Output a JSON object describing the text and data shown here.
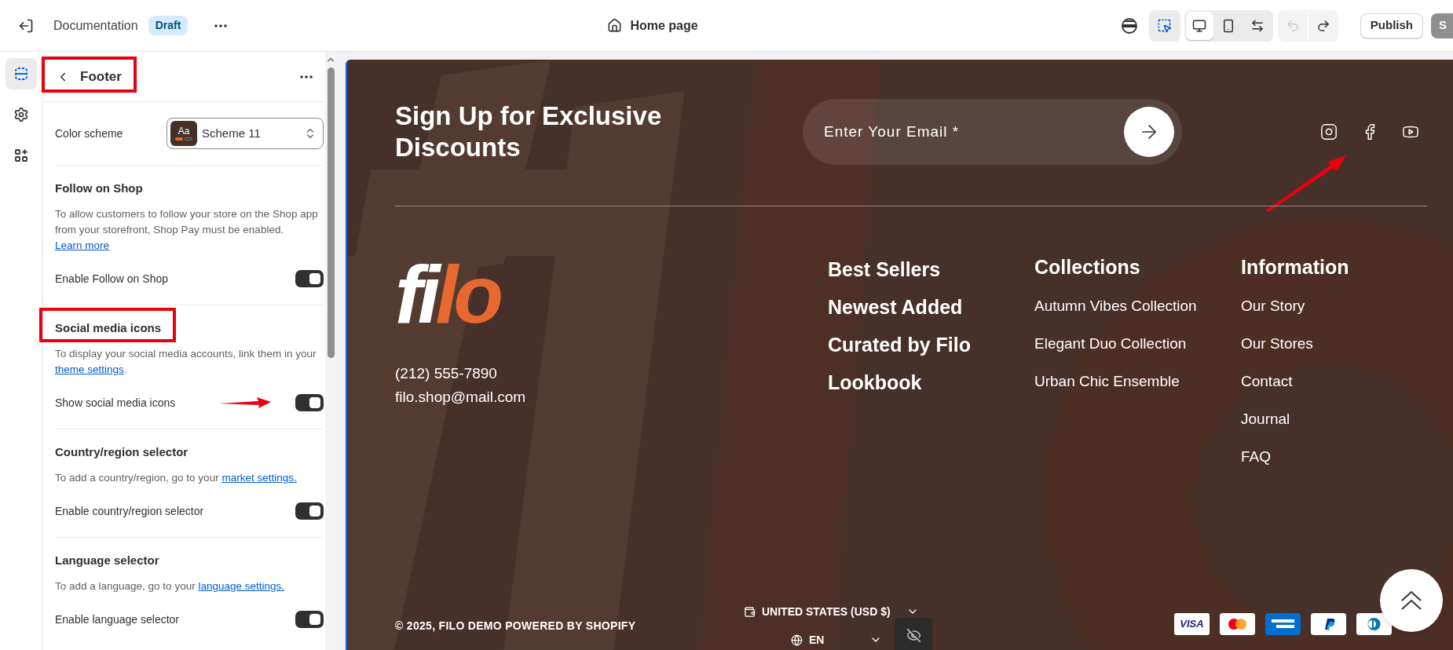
{
  "topbar": {
    "store": "Documentation",
    "status_badge": "Draft",
    "page": "Home page",
    "inspector_selected": true,
    "device_modes": [
      {
        "kind": "desktop",
        "selected": true
      },
      {
        "kind": "mobile",
        "selected": false
      },
      {
        "kind": "fullwidth",
        "selected": false
      }
    ],
    "undo_disabled": true,
    "redo_disabled": false,
    "publish": "Publish",
    "save": "S"
  },
  "rail": [
    {
      "kind": "sections",
      "selected": true
    },
    {
      "kind": "settings",
      "selected": false
    },
    {
      "kind": "apps",
      "selected": false
    }
  ],
  "panel": {
    "title": "Footer",
    "title_annotated": true,
    "color_scheme": {
      "label": "Color scheme",
      "swatch": "Aa",
      "value": "Scheme 11"
    },
    "sections": [
      {
        "heading": "Follow on Shop",
        "annotated": false,
        "description": "To allow customers to follow your store on the Shop app from your storefront, Shop Pay must be enabled. ",
        "link": "Learn more",
        "toggle_label": "Enable Follow on Shop",
        "on": true,
        "arrow": false
      },
      {
        "heading": "Social media icons",
        "annotated": true,
        "description": "To display your social media accounts, link them in your ",
        "link": "theme settings",
        "after": ".",
        "toggle_label": "Show social media icons",
        "on": true,
        "arrow": true
      },
      {
        "heading": "Country/region selector",
        "annotated": false,
        "description": "To add a country/region, go to your ",
        "link": "market settings.",
        "toggle_label": "Enable country/region selector",
        "on": true,
        "arrow": false
      },
      {
        "heading": "Language selector",
        "annotated": false,
        "description": "To add a language, go to your ",
        "link": "language settings.",
        "toggle_label": "Enable language selector",
        "on": true,
        "arrow": false
      }
    ]
  },
  "footer": {
    "newsletter_heading": "Sign Up for Exclusive Discounts",
    "email_placeholder": "Enter Your Email *",
    "social": [
      {
        "kind": "instagram"
      },
      {
        "kind": "facebook"
      },
      {
        "kind": "youtube"
      }
    ],
    "social_arrow": true,
    "logo_main": "fi",
    "logo_accent": "lo",
    "phone": "(212) 555-7890",
    "email": "filo.shop@mail.com",
    "featured_links": [
      "Best Sellers",
      "Newest Added",
      "Curated by Filo",
      "Lookbook"
    ],
    "columns": [
      {
        "heading": "Collections",
        "links": [
          "Autumn Vibes Collection",
          "Elegant Duo Collection",
          "Urban Chic Ensemble"
        ]
      },
      {
        "heading": "Information",
        "links": [
          "Our Story",
          "Our Stores",
          "Contact",
          "Journal",
          "FAQ"
        ]
      }
    ],
    "copyright": "© 2025, FILO DEMO POWERED BY SHOPIFY",
    "country": "UNITED STATES (USD $)",
    "language": "EN",
    "payments": [
      {
        "kind": "visa",
        "label": "VISA"
      },
      {
        "kind": "mastercard"
      },
      {
        "kind": "amex"
      },
      {
        "kind": "paypal"
      },
      {
        "kind": "diners"
      }
    ]
  }
}
